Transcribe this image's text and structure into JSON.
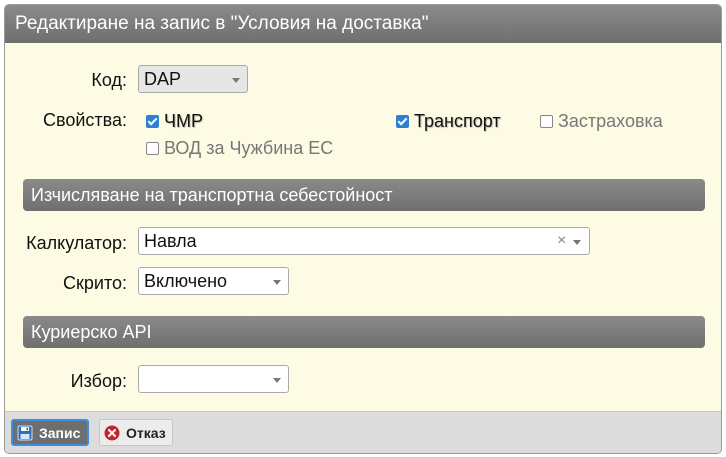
{
  "dialog": {
    "title": "Редактиране на запис в \"Условия на доставка\""
  },
  "fields": {
    "code": {
      "label": "Код:",
      "value": "DAP"
    },
    "properties": {
      "label": "Свойства:",
      "options": [
        {
          "label": "ЧМР",
          "checked": true
        },
        {
          "label": "Транспорт",
          "checked": true
        },
        {
          "label": "Застраховка",
          "checked": false
        },
        {
          "label": "ВОД за Чужбина ЕС",
          "checked": false
        }
      ]
    }
  },
  "sections": {
    "transport": {
      "title": "Изчисляване на транспортна себестойност"
    },
    "courier": {
      "title": "Куриерско API"
    }
  },
  "transport": {
    "calculator": {
      "label": "Калкулатор:",
      "value": "Навла",
      "clear": "×"
    },
    "hidden": {
      "label": "Скрито:",
      "value": "Включено"
    }
  },
  "courier": {
    "choice": {
      "label": "Избор:",
      "value": ""
    }
  },
  "footer": {
    "save_label": "Запис",
    "cancel_label": "Отказ"
  },
  "icons": {
    "save": "floppy-disk-icon",
    "cancel": "close-circle-icon"
  },
  "colors": {
    "accent": "#2f7fd3",
    "header": "#7a7a7a",
    "background": "#fdfbe3",
    "cancel_icon": "#c0282d"
  }
}
